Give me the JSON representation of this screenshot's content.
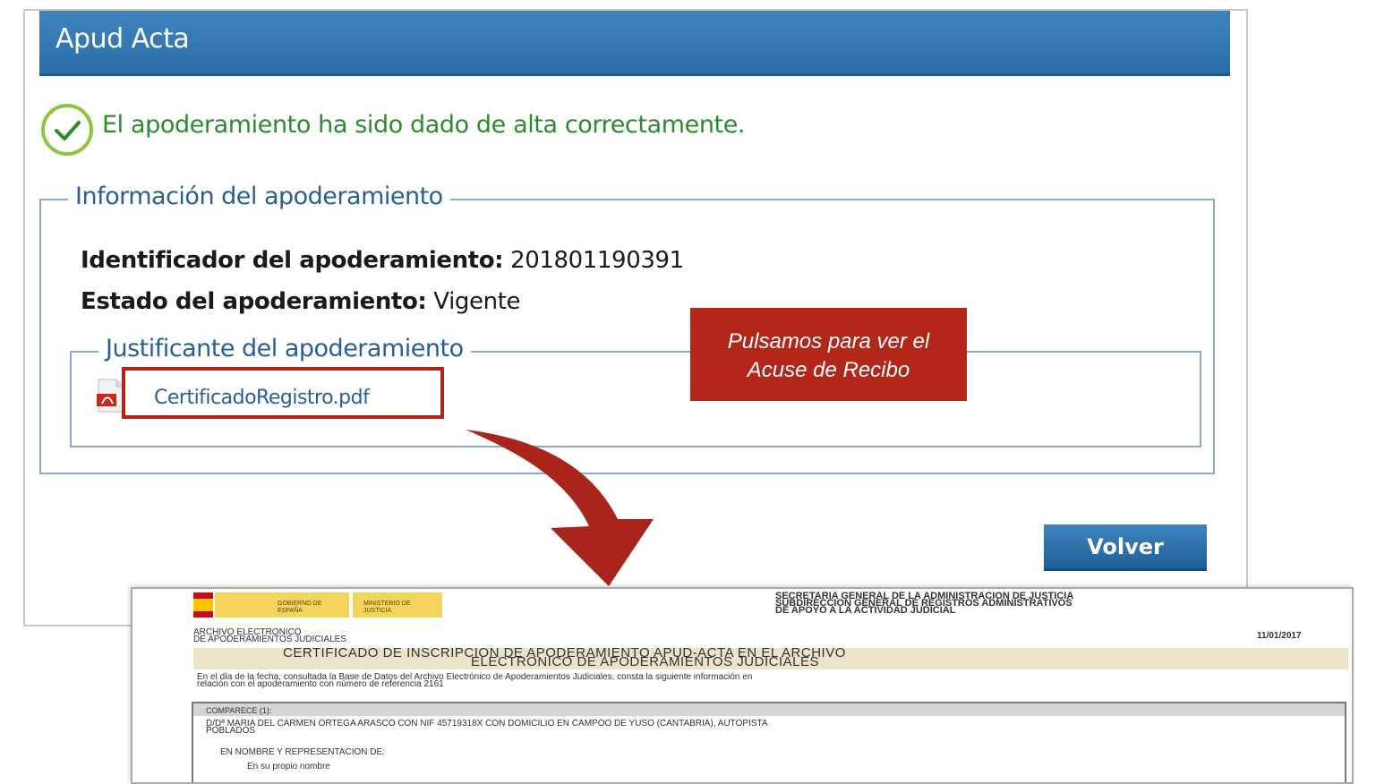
{
  "panel": {
    "title": "Apud Acta",
    "success_message": "El apoderamiento ha sido dado de alta correctamente.",
    "info_legend": "Información del apoderamiento",
    "identificador_label": "Identificador del apoderamiento:",
    "identificador_value": "201801190391",
    "estado_label": "Estado del apoderamiento:",
    "estado_value": "Vigente",
    "justificante_legend": "Justificante del apoderamiento",
    "pdf_link": "CertificadoRegistro.pdf",
    "volver_button": "Volver"
  },
  "callout": {
    "line1": "Pulsamos para ver el",
    "line2": "Acuse de Recibo"
  },
  "document": {
    "logo_gobierno": "GOBIERNO DE ESPAÑA",
    "logo_ministerio": "MINISTERIO DE JUSTICIA",
    "header_line1": "SECRETARIA GENERAL DE LA ADMINISTRACION DE JUSTICIA",
    "header_line2": "SUBDIRECCION GENERAL DE REGISTROS ADMINISTRATIVOS",
    "header_line3": "DE APOYO A LA ACTIVIDAD JUDICIAL",
    "archive_line1": "ARCHIVO ELECTRONICO",
    "archive_line2": "DE APODERAMIENTOS JUDICIALES",
    "date": "11/01/2017",
    "title_line1": "CERTIFICADO DE INSCRIPCION DE APODERAMIENTO APUD-ACTA EN EL ARCHIVO",
    "title_line2": "ELECTRONICO DE APODERAMIENTOS JUDICIALES",
    "intro_line1": "En el día de la fecha, consultada la Base de Datos del Archivo Electrónico de Apoderamientos Judiciales, consta la siguiente información en",
    "intro_line2": "relación con el apoderamiento con número de referencia 2161",
    "comparece_header": "COMPARECE (1):",
    "comparece_line1": "D/Dª MARIA DEL CARMEN ORTEGA ARASCO CON NIF 45719318X CON DOMICILIO EN CAMPOO DE YUSO (CANTABRIA), AUTOPISTA",
    "comparece_line2": "POBLADOS",
    "representacion": "EN NOMBRE Y REPRESENTACION DE:",
    "propio_nombre": "En su propio nombre"
  },
  "colors": {
    "header_blue": "#2a6ea8",
    "success_green": "#2e8a2e",
    "callout_red": "#b3261a",
    "link_blue": "#2b5f92"
  }
}
